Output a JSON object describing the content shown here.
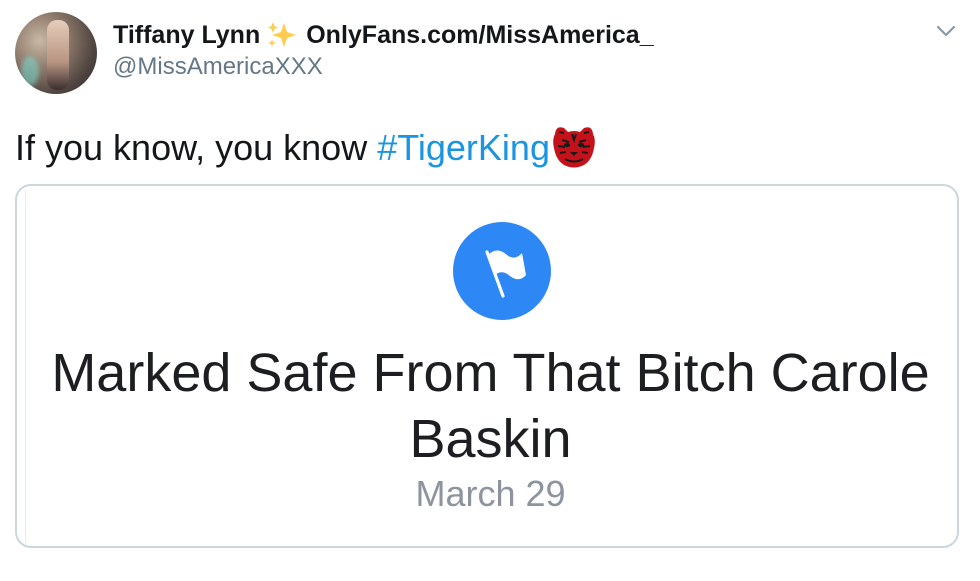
{
  "tweet": {
    "author_name": "Tiffany Lynn",
    "author_suffix": "OnlyFans.com/MissAmerica_",
    "handle": "@MissAmericaXXX",
    "text_before": "If you know, you know ",
    "hashtag": "#TigerKing",
    "emoji_icon": "tiger-face-icon"
  },
  "card": {
    "icon": "flag-icon",
    "title": "Marked Safe From That Bitch Carole Baskin",
    "date": "March 29"
  },
  "colors": {
    "hashtag": "#1b95e0",
    "flag_circle": "#2d88f5",
    "secondary_text": "#657786"
  }
}
